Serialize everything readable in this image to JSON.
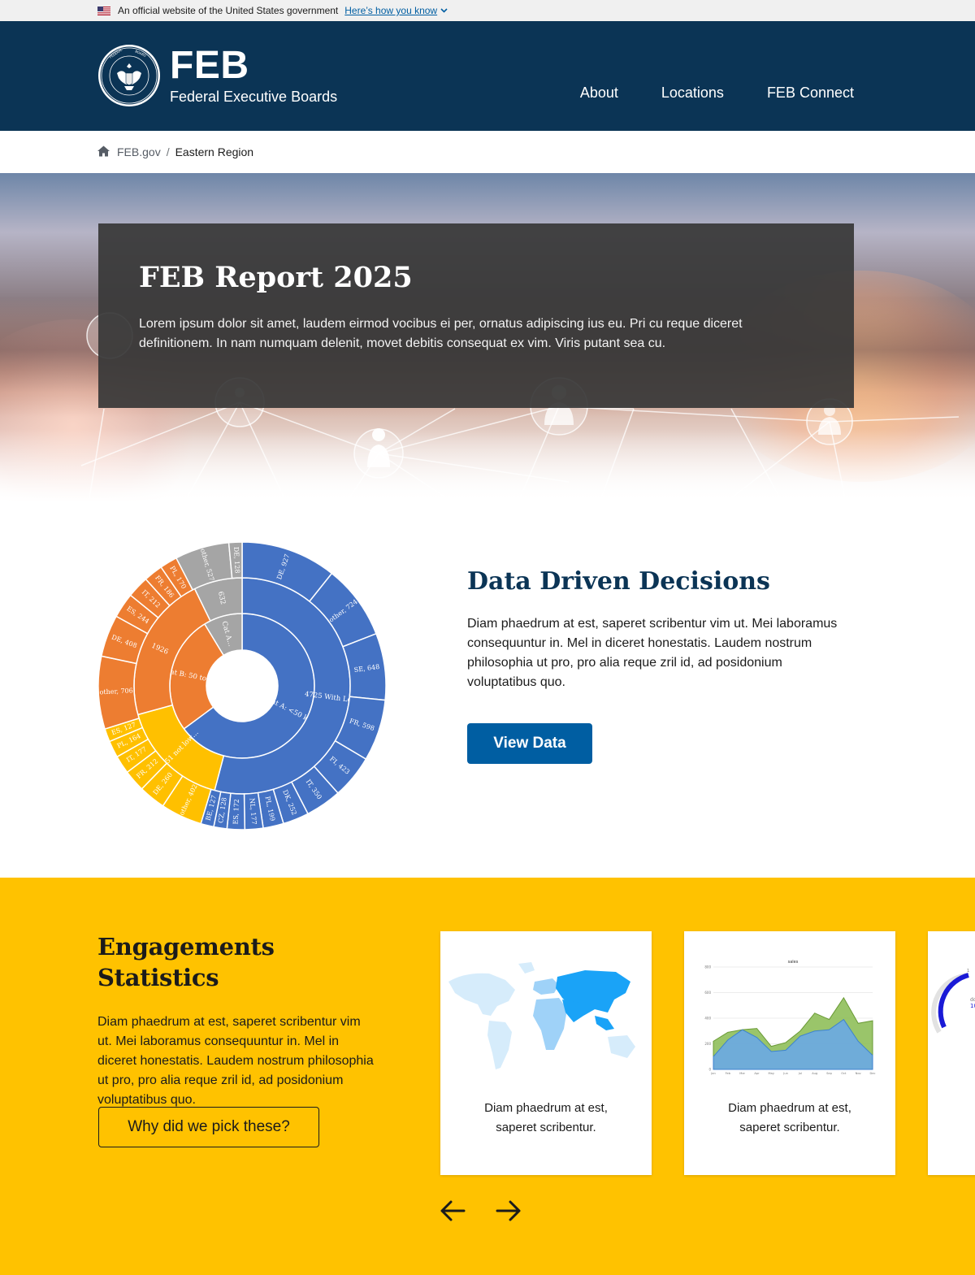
{
  "gov_banner": {
    "text": "An official website of the United States government",
    "link": "Here’s how you know"
  },
  "header": {
    "abbr": "FEB",
    "name": "Federal Executive Boards",
    "nav": [
      "About",
      "Locations",
      "FEB Connect"
    ]
  },
  "breadcrumb": {
    "home": "FEB.gov",
    "current": "Eastern Region"
  },
  "hero": {
    "title": "FEB Report 2025",
    "body": "Lorem ipsum dolor sit amet, laudem eirmod vocibus ei per, ornatus adipiscing ius eu. Pri cu reque diceret definitionem. In nam numquam delenit, movet debitis consequat ex vim. Viris putant sea cu."
  },
  "data_section": {
    "title": "Data Driven Decisions",
    "body": "Diam phaedrum at est, saperet scribentur vim ut. Mei laboramus consequuntur in. Mel in diceret honestatis. Laudem nostrum philosophia ut pro, pro alia reque zril id, ad posidonium voluptatibus quo.",
    "button": "View Data"
  },
  "engagement": {
    "title": "Engagements Statistics",
    "body": "Diam phaedrum at est, saperet scribentur vim ut. Mei laboramus consequuntur in. Mel in diceret honestatis. Laudem nostrum philosophia ut pro, pro alia reque zril id, ad posidonium voluptatibus quo.",
    "button": "Why did we pick these?",
    "cards": [
      {
        "caption": "Diam phaedrum at est, saperet scribentur."
      },
      {
        "caption": "Diam phaedrum at est, saperet scribentur."
      },
      {
        "caption": ""
      }
    ]
  },
  "chart_data": [
    {
      "type": "sunburst",
      "colors": {
        "cat_a": "#4472c4",
        "cat_b": "#ed7d31",
        "cat_c": "#ffc000",
        "other": "#a5a5a5"
      },
      "inner": [
        {
          "label": "Cat A: <50 kt CO2/year",
          "value": 4725,
          "color": "#4472c4"
        },
        {
          "label": "Cat B: 50 to 500 kt CO2/year",
          "value": 1926,
          "color": "#ed7d31"
        },
        {
          "label": "Cat A...",
          "value": 632,
          "color": "#a5a5a5"
        }
      ],
      "middle": [
        {
          "label": "4725 With Low Emissions",
          "value": 4725,
          "color": "#4472c4"
        },
        {
          "label": "1451 not low emission",
          "value": 1451,
          "color": "#ffc000"
        },
        {
          "label": "1926",
          "value": 1926,
          "color": "#ed7d31"
        },
        {
          "label": "632",
          "value": 632,
          "color": "#a5a5a5"
        }
      ],
      "outer": [
        {
          "label": "DE, 927",
          "value": 927,
          "color": "#4472c4"
        },
        {
          "label": "other, 724",
          "value": 724,
          "color": "#4472c4"
        },
        {
          "label": "SE, 648",
          "value": 648,
          "color": "#4472c4"
        },
        {
          "label": "FR, 598",
          "value": 598,
          "color": "#4472c4"
        },
        {
          "label": "FI, 423",
          "value": 423,
          "color": "#4472c4"
        },
        {
          "label": "IT, 350",
          "value": 350,
          "color": "#4472c4"
        },
        {
          "label": "DK, 252",
          "value": 252,
          "color": "#4472c4"
        },
        {
          "label": "PL, 199",
          "value": 199,
          "color": "#4472c4"
        },
        {
          "label": "NL, 177",
          "value": 177,
          "color": "#4472c4"
        },
        {
          "label": "ES, 172",
          "value": 172,
          "color": "#4472c4"
        },
        {
          "label": "CZ, 128",
          "value": 128,
          "color": "#4472c4"
        },
        {
          "label": "BE, 127",
          "value": 127,
          "color": "#4472c4"
        },
        {
          "label": "other, 402",
          "value": 402,
          "color": "#ffc000"
        },
        {
          "label": "DE, 260",
          "value": 260,
          "color": "#ffc000"
        },
        {
          "label": "FR, 212",
          "value": 212,
          "color": "#ffc000"
        },
        {
          "label": "IT, 177",
          "value": 177,
          "color": "#ffc000"
        },
        {
          "label": "PL, 164",
          "value": 164,
          "color": "#ffc000"
        },
        {
          "label": "ES, 127",
          "value": 127,
          "color": "#ffc000"
        },
        {
          "label": "other, 706",
          "value": 706,
          "color": "#ed7d31"
        },
        {
          "label": "DE, 408",
          "value": 408,
          "color": "#ed7d31"
        },
        {
          "label": "ES, 244",
          "value": 244,
          "color": "#ed7d31"
        },
        {
          "label": "IT, 212",
          "value": 212,
          "color": "#ed7d31"
        },
        {
          "label": "FR, 186",
          "value": 186,
          "color": "#ed7d31"
        },
        {
          "label": "PL, 170",
          "value": 170,
          "color": "#ed7d31"
        },
        {
          "label": "other, 527",
          "value": 527,
          "color": "#a5a5a5"
        },
        {
          "label": "DE, 128",
          "value": 128,
          "color": "#a5a5a5"
        }
      ]
    },
    {
      "type": "area",
      "title": "sales",
      "categories": [
        "Jan",
        "Feb",
        "Mar",
        "Apr",
        "May",
        "Jun",
        "Jul",
        "Aug",
        "Sep",
        "Oct",
        "Nov",
        "Dec"
      ],
      "ylim": [
        0,
        800
      ],
      "yticks": [
        0,
        200,
        400,
        600,
        800
      ],
      "series": [
        {
          "values": [
            220,
            290,
            310,
            320,
            180,
            210,
            300,
            440,
            390,
            560,
            360,
            380
          ],
          "color": "#8fbf5a"
        },
        {
          "values": [
            100,
            230,
            310,
            250,
            140,
            150,
            260,
            300,
            310,
            390,
            220,
            110
          ],
          "color": "#6aa8e6"
        }
      ]
    }
  ]
}
